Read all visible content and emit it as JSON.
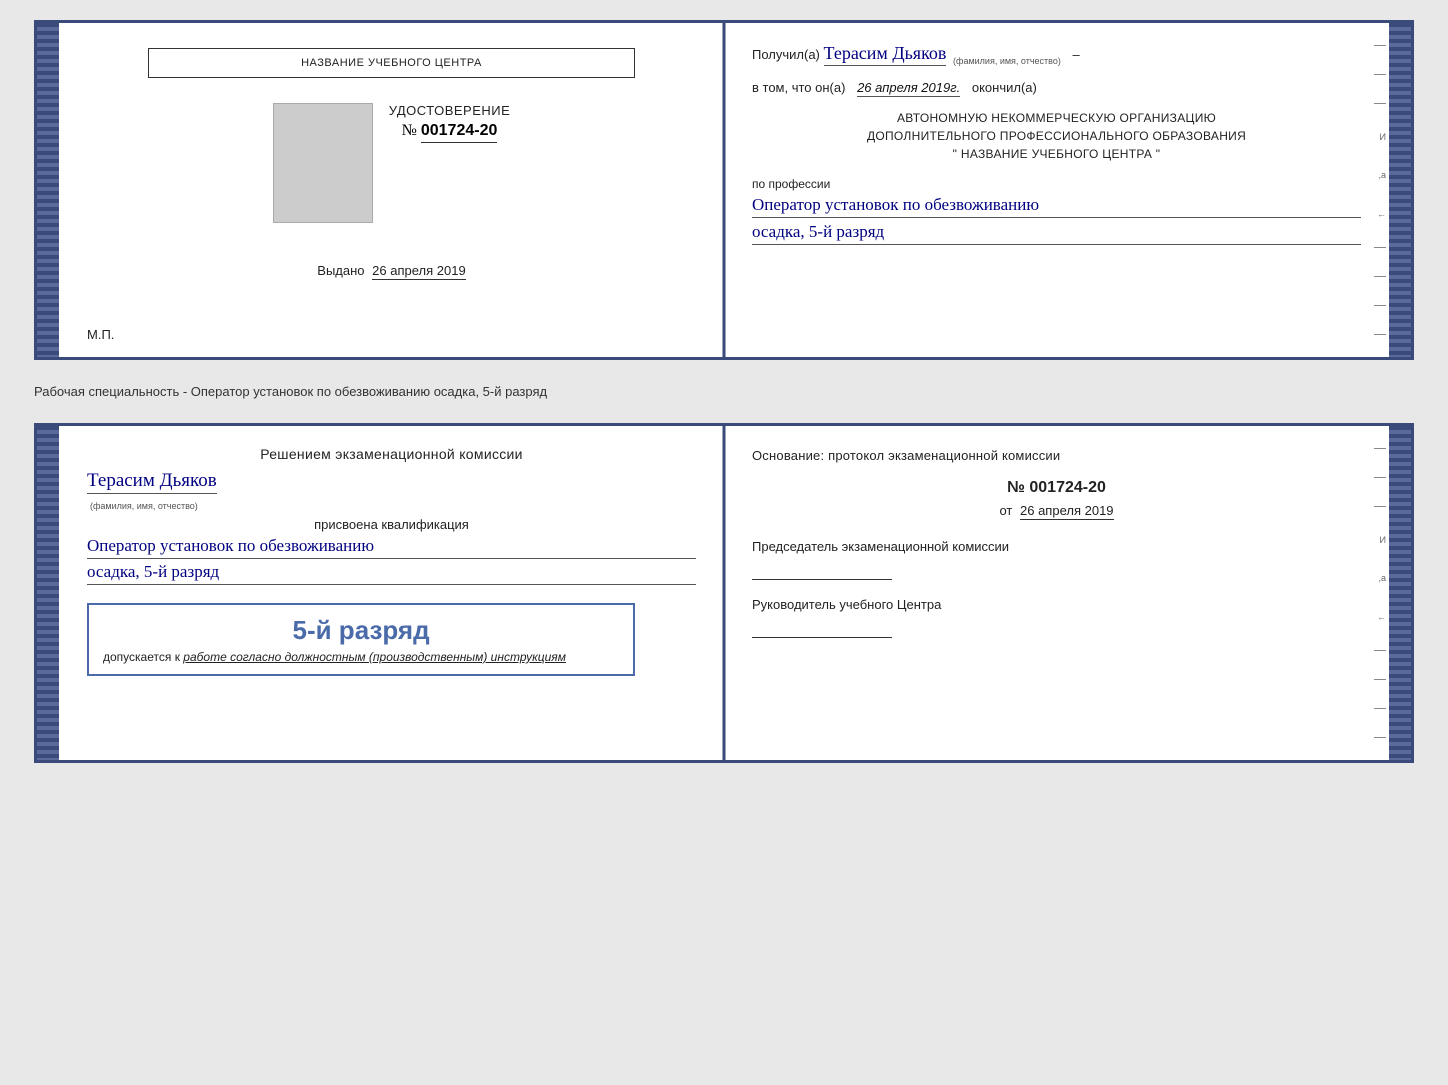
{
  "top_card": {
    "left": {
      "institution_name": "НАЗВАНИЕ УЧЕБНОГО ЦЕНТРА",
      "photo_alt": "photo",
      "cert_title": "УДОСТОВЕРЕНИЕ",
      "cert_number_prefix": "№",
      "cert_number": "001724-20",
      "vydano_label": "Выдано",
      "vydano_date": "26 апреля 2019",
      "mp_label": "М.П."
    },
    "right": {
      "poluchil_prefix": "Получил(а)",
      "recipient_name": "Терасим Дьяков",
      "fio_label": "(фамилия, имя, отчество)",
      "dash": "–",
      "vtom_prefix": "в том, что он(а)",
      "vtom_date": "26 апреля 2019г.",
      "okonchil": "окончил(а)",
      "org_line1": "АВТОНОМНУЮ НЕКОММЕРЧЕСКУЮ ОРГАНИЗАЦИЮ",
      "org_line2": "ДОПОЛНИТЕЛЬНОГО ПРОФЕССИОНАЛЬНОГО ОБРАЗОВАНИЯ",
      "org_line3": "\"  НАЗВАНИЕ УЧЕБНОГО ЦЕНТРА  \"",
      "po_professii": "по профессии",
      "profession": "Оператор установок по обезвоживанию",
      "razryad": "осадка, 5-й разряд"
    }
  },
  "middle_label": "Рабочая специальность - Оператор установок по обезвоживанию осадка, 5-й разряд",
  "bottom_card": {
    "left": {
      "resheniem_title": "Решением экзаменационной комиссии",
      "person_name": "Терасим Дьяков",
      "fio_label": "(фамилия, имя, отчество)",
      "prisvoena": "присвоена квалификация",
      "qualification": "Оператор установок по обезвоживанию",
      "razryad": "осадка, 5-й разряд",
      "stamp_razryad": "5-й разряд",
      "dopuskaetsya": "допускается к",
      "rabota_italic": "работе согласно должностным (производственным) инструкциям"
    },
    "right": {
      "osnovaniye": "Основание: протокол экзаменационной комиссии",
      "protocol_number": "№  001724-20",
      "ot_label": "от",
      "ot_date": "26 апреля 2019",
      "predsedatel_label": "Председатель экзаменационной комиссии",
      "rukovoditel_label": "Руководитель учебного Центра"
    }
  },
  "edge_chars": [
    "–",
    "–",
    "–",
    "И",
    ",а",
    "←",
    "–",
    "–",
    "–",
    "–"
  ]
}
